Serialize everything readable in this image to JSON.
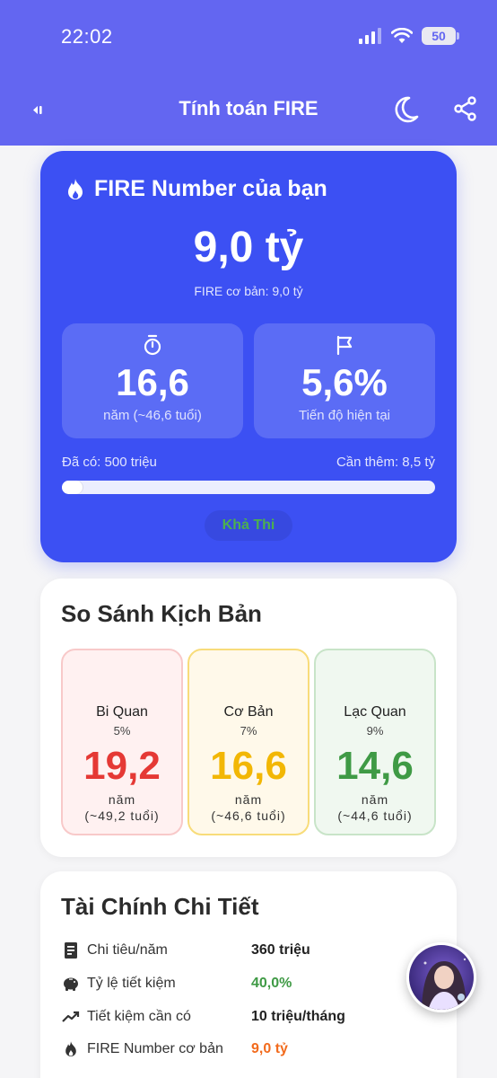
{
  "status": {
    "time": "22:02",
    "battery": "50"
  },
  "header": {
    "title": "Tính toán FIRE"
  },
  "fire_card": {
    "title": "FIRE Number của bạn",
    "amount": "9,0 tỷ",
    "base_label": "FIRE cơ bản: 9,0 tỷ",
    "years": {
      "value": "16,6",
      "label": "năm (~46,6 tuổi)"
    },
    "progress_stat": {
      "value": "5,6%",
      "label": "Tiến độ hiện tại"
    },
    "have_label": "Đã có: 500 triệu",
    "need_label": "Cần thêm: 8,5 tỷ",
    "progress_fraction": 0.056,
    "feasibility_badge": "Khả Thi"
  },
  "scenarios": {
    "title": "So Sánh Kịch Bản",
    "items": [
      {
        "name": "Bi Quan",
        "rate": "5%",
        "years": "19,2",
        "unit": "năm",
        "age": "(~49,2 tuổi)",
        "color": "#e53935",
        "bg": "#fff1f1",
        "border": "#f8c9c9"
      },
      {
        "name": "Cơ Bản",
        "rate": "7%",
        "years": "16,6",
        "unit": "năm",
        "age": "(~46,6 tuổi)",
        "color": "#f2b705",
        "bg": "#fff9ea",
        "border": "#f8dc7a"
      },
      {
        "name": "Lạc Quan",
        "rate": "9%",
        "years": "14,6",
        "unit": "năm",
        "age": "(~44,6 tuổi)",
        "color": "#3f9a45",
        "bg": "#f0f8f0",
        "border": "#c8e4c8"
      }
    ]
  },
  "finance": {
    "title": "Tài Chính Chi Tiết",
    "rows": [
      {
        "label": "Chi tiêu/năm",
        "value": "360 triệu",
        "icon": "receipt-icon",
        "color": "#222222"
      },
      {
        "label": "Tỷ lệ tiết kiệm",
        "value": "40,0%",
        "icon": "piggy-bank-icon",
        "color": "#3f9a45"
      },
      {
        "label": "Tiết kiệm cần có",
        "value": "10 triệu/tháng",
        "icon": "trending-up-icon",
        "color": "#222222"
      },
      {
        "label": "FIRE Number cơ bản",
        "value": "9,0 tỷ",
        "icon": "fire-icon",
        "color": "#f26b1d"
      }
    ]
  },
  "colors": {
    "header": "#6366f1",
    "card": "#3c50f3",
    "accent_green": "#4caf50"
  }
}
